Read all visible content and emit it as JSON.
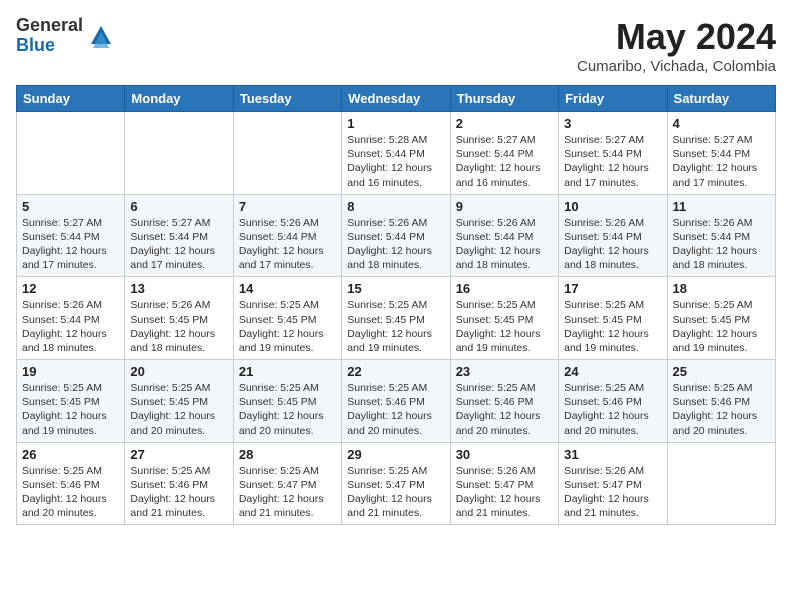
{
  "logo": {
    "general": "General",
    "blue": "Blue"
  },
  "title": "May 2024",
  "location": "Cumaribo, Vichada, Colombia",
  "weekdays": [
    "Sunday",
    "Monday",
    "Tuesday",
    "Wednesday",
    "Thursday",
    "Friday",
    "Saturday"
  ],
  "weeks": [
    [
      {
        "day": "",
        "sunrise": "",
        "sunset": "",
        "daylight": ""
      },
      {
        "day": "",
        "sunrise": "",
        "sunset": "",
        "daylight": ""
      },
      {
        "day": "",
        "sunrise": "",
        "sunset": "",
        "daylight": ""
      },
      {
        "day": "1",
        "sunrise": "Sunrise: 5:28 AM",
        "sunset": "Sunset: 5:44 PM",
        "daylight": "Daylight: 12 hours and 16 minutes."
      },
      {
        "day": "2",
        "sunrise": "Sunrise: 5:27 AM",
        "sunset": "Sunset: 5:44 PM",
        "daylight": "Daylight: 12 hours and 16 minutes."
      },
      {
        "day": "3",
        "sunrise": "Sunrise: 5:27 AM",
        "sunset": "Sunset: 5:44 PM",
        "daylight": "Daylight: 12 hours and 17 minutes."
      },
      {
        "day": "4",
        "sunrise": "Sunrise: 5:27 AM",
        "sunset": "Sunset: 5:44 PM",
        "daylight": "Daylight: 12 hours and 17 minutes."
      }
    ],
    [
      {
        "day": "5",
        "sunrise": "Sunrise: 5:27 AM",
        "sunset": "Sunset: 5:44 PM",
        "daylight": "Daylight: 12 hours and 17 minutes."
      },
      {
        "day": "6",
        "sunrise": "Sunrise: 5:27 AM",
        "sunset": "Sunset: 5:44 PM",
        "daylight": "Daylight: 12 hours and 17 minutes."
      },
      {
        "day": "7",
        "sunrise": "Sunrise: 5:26 AM",
        "sunset": "Sunset: 5:44 PM",
        "daylight": "Daylight: 12 hours and 17 minutes."
      },
      {
        "day": "8",
        "sunrise": "Sunrise: 5:26 AM",
        "sunset": "Sunset: 5:44 PM",
        "daylight": "Daylight: 12 hours and 18 minutes."
      },
      {
        "day": "9",
        "sunrise": "Sunrise: 5:26 AM",
        "sunset": "Sunset: 5:44 PM",
        "daylight": "Daylight: 12 hours and 18 minutes."
      },
      {
        "day": "10",
        "sunrise": "Sunrise: 5:26 AM",
        "sunset": "Sunset: 5:44 PM",
        "daylight": "Daylight: 12 hours and 18 minutes."
      },
      {
        "day": "11",
        "sunrise": "Sunrise: 5:26 AM",
        "sunset": "Sunset: 5:44 PM",
        "daylight": "Daylight: 12 hours and 18 minutes."
      }
    ],
    [
      {
        "day": "12",
        "sunrise": "Sunrise: 5:26 AM",
        "sunset": "Sunset: 5:44 PM",
        "daylight": "Daylight: 12 hours and 18 minutes."
      },
      {
        "day": "13",
        "sunrise": "Sunrise: 5:26 AM",
        "sunset": "Sunset: 5:45 PM",
        "daylight": "Daylight: 12 hours and 18 minutes."
      },
      {
        "day": "14",
        "sunrise": "Sunrise: 5:25 AM",
        "sunset": "Sunset: 5:45 PM",
        "daylight": "Daylight: 12 hours and 19 minutes."
      },
      {
        "day": "15",
        "sunrise": "Sunrise: 5:25 AM",
        "sunset": "Sunset: 5:45 PM",
        "daylight": "Daylight: 12 hours and 19 minutes."
      },
      {
        "day": "16",
        "sunrise": "Sunrise: 5:25 AM",
        "sunset": "Sunset: 5:45 PM",
        "daylight": "Daylight: 12 hours and 19 minutes."
      },
      {
        "day": "17",
        "sunrise": "Sunrise: 5:25 AM",
        "sunset": "Sunset: 5:45 PM",
        "daylight": "Daylight: 12 hours and 19 minutes."
      },
      {
        "day": "18",
        "sunrise": "Sunrise: 5:25 AM",
        "sunset": "Sunset: 5:45 PM",
        "daylight": "Daylight: 12 hours and 19 minutes."
      }
    ],
    [
      {
        "day": "19",
        "sunrise": "Sunrise: 5:25 AM",
        "sunset": "Sunset: 5:45 PM",
        "daylight": "Daylight: 12 hours and 19 minutes."
      },
      {
        "day": "20",
        "sunrise": "Sunrise: 5:25 AM",
        "sunset": "Sunset: 5:45 PM",
        "daylight": "Daylight: 12 hours and 20 minutes."
      },
      {
        "day": "21",
        "sunrise": "Sunrise: 5:25 AM",
        "sunset": "Sunset: 5:45 PM",
        "daylight": "Daylight: 12 hours and 20 minutes."
      },
      {
        "day": "22",
        "sunrise": "Sunrise: 5:25 AM",
        "sunset": "Sunset: 5:46 PM",
        "daylight": "Daylight: 12 hours and 20 minutes."
      },
      {
        "day": "23",
        "sunrise": "Sunrise: 5:25 AM",
        "sunset": "Sunset: 5:46 PM",
        "daylight": "Daylight: 12 hours and 20 minutes."
      },
      {
        "day": "24",
        "sunrise": "Sunrise: 5:25 AM",
        "sunset": "Sunset: 5:46 PM",
        "daylight": "Daylight: 12 hours and 20 minutes."
      },
      {
        "day": "25",
        "sunrise": "Sunrise: 5:25 AM",
        "sunset": "Sunset: 5:46 PM",
        "daylight": "Daylight: 12 hours and 20 minutes."
      }
    ],
    [
      {
        "day": "26",
        "sunrise": "Sunrise: 5:25 AM",
        "sunset": "Sunset: 5:46 PM",
        "daylight": "Daylight: 12 hours and 20 minutes."
      },
      {
        "day": "27",
        "sunrise": "Sunrise: 5:25 AM",
        "sunset": "Sunset: 5:46 PM",
        "daylight": "Daylight: 12 hours and 21 minutes."
      },
      {
        "day": "28",
        "sunrise": "Sunrise: 5:25 AM",
        "sunset": "Sunset: 5:47 PM",
        "daylight": "Daylight: 12 hours and 21 minutes."
      },
      {
        "day": "29",
        "sunrise": "Sunrise: 5:25 AM",
        "sunset": "Sunset: 5:47 PM",
        "daylight": "Daylight: 12 hours and 21 minutes."
      },
      {
        "day": "30",
        "sunrise": "Sunrise: 5:26 AM",
        "sunset": "Sunset: 5:47 PM",
        "daylight": "Daylight: 12 hours and 21 minutes."
      },
      {
        "day": "31",
        "sunrise": "Sunrise: 5:26 AM",
        "sunset": "Sunset: 5:47 PM",
        "daylight": "Daylight: 12 hours and 21 minutes."
      },
      {
        "day": "",
        "sunrise": "",
        "sunset": "",
        "daylight": ""
      }
    ]
  ]
}
